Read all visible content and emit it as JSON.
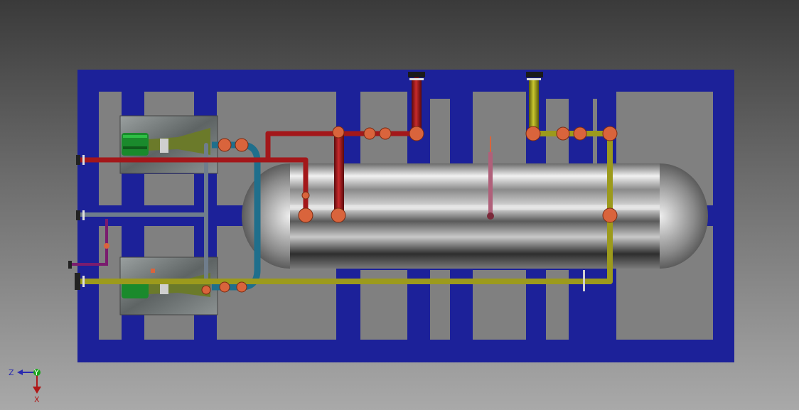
{
  "scene": {
    "description_free": true,
    "colors": {
      "skid_frame": "#1c2199",
      "frame_opening": "#7f7f7f",
      "red_pipe": "#a3171a",
      "yellow_pipe": "#9c9a1c",
      "steel_pipe": "#6f7d8c",
      "teal_pipe": "#1f6f8c",
      "purple_pipe": "#7a1c6e",
      "pink_pipe": "#b0607a",
      "flange_orange": "#d9643c",
      "motor_green": "#1a8a2c",
      "pump_olive": "#6b7a2a"
    }
  },
  "triad": {
    "z_label": "Z",
    "y_label": "Y",
    "x_label": "X",
    "z_color": "#2a2ab0",
    "y_color": "#1aa61a",
    "x_color": "#b01818"
  }
}
